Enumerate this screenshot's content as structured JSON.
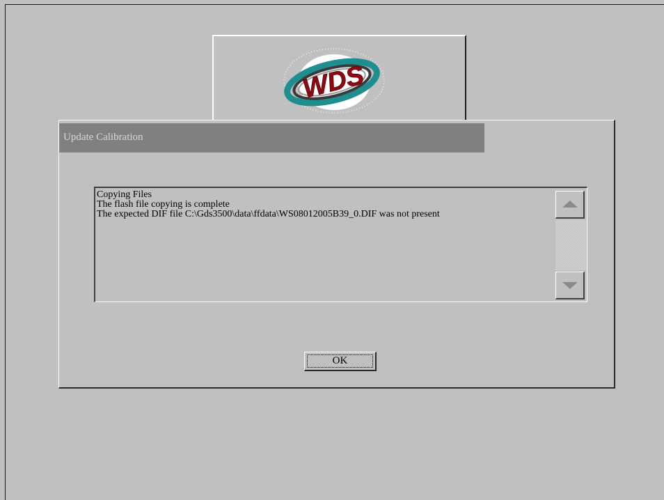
{
  "logo": {
    "text": "WDS",
    "colors": {
      "ring_outer": "#1f8e8e",
      "ring_inner": "#3a3a3a",
      "text": "#8b0a14"
    }
  },
  "dialog": {
    "title": "Update Calibration",
    "messages": [
      "Copying Files",
      "The flash file copying is complete",
      "The expected DIF file C:\\Gds3500\\data\\ffdata\\WS08012005B39_0.DIF was not present"
    ],
    "ok_label": "OK"
  },
  "colors": {
    "background": "#c0c0c0",
    "titlebar": "#808080",
    "title_text": "#d8d8d8"
  }
}
